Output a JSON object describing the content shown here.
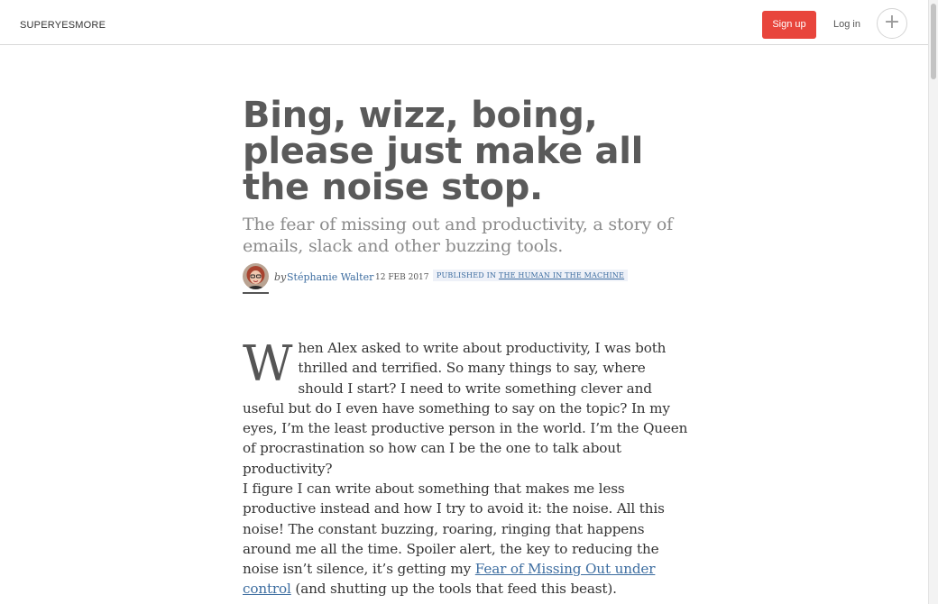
{
  "header": {
    "brand": "SUPERYESMORE",
    "signup_label": "Sign up",
    "login_label": "Log in",
    "plus_icon": "+"
  },
  "article": {
    "title": "Bing, wizz, boing, please just make all the noise stop.",
    "subtitle": "The fear of missing out and productivity, a story of emails, slack and other buzzing tools.",
    "byline": {
      "by": "by",
      "author": "Stéphanie Walter",
      "date": "12 FEB 2017",
      "published_prefix": "PUBLISHED IN",
      "publication": "THE HUMAN IN THE MACHINE"
    },
    "paragraph1": {
      "dropcap": "W",
      "text": "hen Alex asked to write about productivity, I was both thrilled and terrified. So many things to say, where should I start? I need to write something clever and useful but do I even have something to say on the topic? In my eyes, I’m the least productive person in the world. I’m the Queen of procrastination so how can I be the one to talk about productivity?"
    },
    "paragraph2": {
      "before_link": "I figure I can write about something that makes me less productive instead and how I try to avoid it: the noise. All this noise! The constant buzzing, roaring, ringing that happens around me all the time. Spoiler alert, the key to reducing the noise isn’t silence, it’s getting my ",
      "link": "Fear of Missing Out under control",
      "after_link": " (and shutting up the tools that feed this beast)."
    }
  },
  "colors": {
    "accent": "#e8453c",
    "link": "#3d6da0",
    "title": "#5a5a5a",
    "subtitle": "#8b8b8b"
  }
}
